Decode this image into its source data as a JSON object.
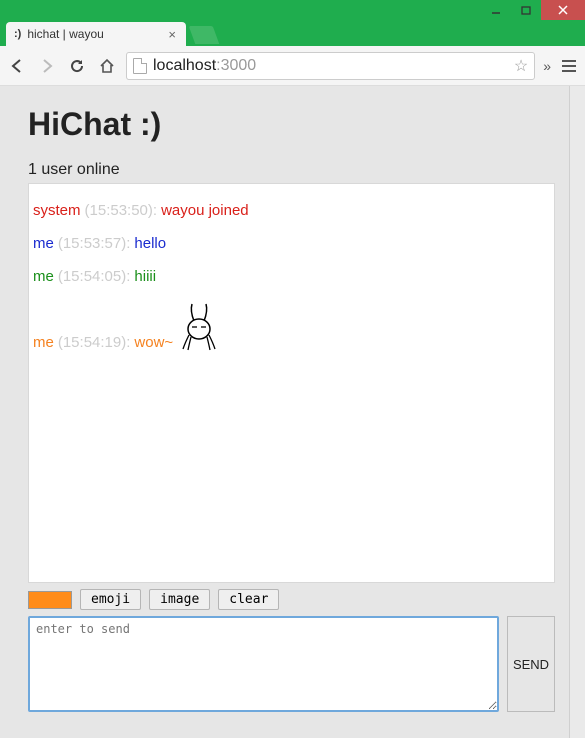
{
  "browser": {
    "tab": {
      "favicon": ":)",
      "title": "hichat | wayou"
    },
    "url": {
      "host": "localhost",
      "port": ":3000"
    }
  },
  "app": {
    "title": "HiChat :)",
    "user_count_text": "1 user online"
  },
  "messages": [
    {
      "sender": "system",
      "time": "(15:53:50):",
      "text": "wayou joined",
      "cls": "sys"
    },
    {
      "sender": "me",
      "time": "(15:53:57):",
      "text": "hello",
      "cls": "me1"
    },
    {
      "sender": "me",
      "time": "(15:54:05):",
      "text": "hiiii",
      "cls": "me2"
    },
    {
      "sender": "me",
      "time": "(15:54:19):",
      "text": "wow~",
      "cls": "me3",
      "has_emoji": true
    }
  ],
  "toolbar": {
    "color": "#ff8c1a",
    "emoji_label": "emoji",
    "image_label": "image",
    "clear_label": "clear"
  },
  "input": {
    "placeholder": "enter to send",
    "send_label": "SEND"
  }
}
